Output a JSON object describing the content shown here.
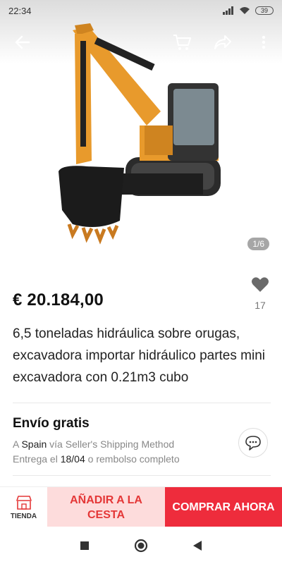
{
  "status_bar": {
    "time": "22:34",
    "battery": "39",
    "icons": [
      "signal-icon",
      "wifi-icon",
      "battery-icon"
    ]
  },
  "top_actions": {
    "back": "back-arrow-icon",
    "cart": "cart-icon",
    "share": "share-icon",
    "more": "more-vertical-icon"
  },
  "gallery": {
    "pager": "1/6"
  },
  "product": {
    "price": "€ 20.184,00",
    "wishlist_count": "17",
    "title": "6,5 toneladas hidráulica sobre orugas, excavadora importar hidráulico partes mini excavadora con 0.21m3 cubo"
  },
  "shipping": {
    "title": "Envío gratis",
    "to_prefix": "A",
    "to_country": "Spain",
    "method": "vía Seller's Shipping Method",
    "delivery_prefix": "Entrega el",
    "delivery_date": "18/04",
    "delivery_suffix": "o rembolso completo"
  },
  "action_bar": {
    "store_label": "TIENDA",
    "add_to_cart": "AÑADIR A LA CESTA",
    "buy_now": "COMPRAR AHORA"
  },
  "colors": {
    "buy_now_bg": "#ee2c3c",
    "add_cart_bg": "#fddcdc",
    "add_cart_text": "#e43737",
    "excavator_body": "#e89a2c"
  }
}
